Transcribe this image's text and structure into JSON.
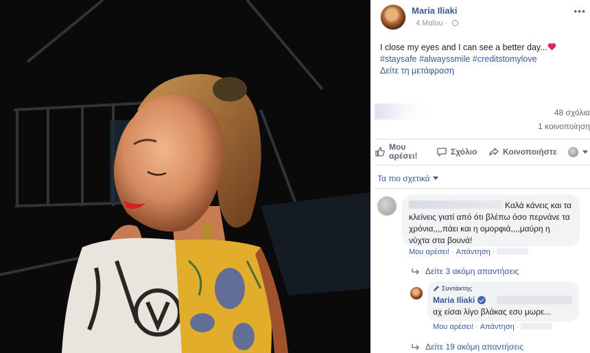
{
  "post": {
    "author": "Maria Iliaki",
    "date": "4 Μαΐου",
    "text": "I close my eyes and I can see a better day...",
    "hashtags": "#staysafe #alwayssmile #creditstomylove",
    "translate": "Δείτε τη μετάφραση",
    "more_icon": "ellipsis-icon",
    "privacy_icon": "globe-icon"
  },
  "stats": {
    "comments": "48 σχόλια",
    "shares": "1 κοινοποίηση"
  },
  "actions": {
    "like_line1": "Μου",
    "like_line2": "αρέσει!",
    "comment": "Σχόλιο",
    "share": "Κοινοποιήστε"
  },
  "sort": {
    "label": "Τα πιο σχετικά"
  },
  "comment": {
    "text": "Καλά κάνεις και τα κλείνεις γιατί από ότι βλέπω όσο περνάνε τα χρόνια,,,,πάει και η ομορφιά,,,,μαύρη η νύχτα στα βουνά!",
    "like": "Μου αρέσει!",
    "reply": "Απάντηση"
  },
  "replies_more_1": "Δείτε 3 ακόμη απαντήσεις",
  "reply": {
    "badge": "Συντάκτης",
    "author": "Maria Iliaki",
    "text": "αχ είσαι λίγο βλάκας εσυ μωρε...",
    "like": "Μου αρέσει!",
    "reply": "Απάντηση"
  },
  "replies_more_2": "Δείτε 19 ακόμη απαντήσεις",
  "colors": {
    "link": "#385898",
    "heart": "#e0245e",
    "bubble": "#f2f3f5"
  }
}
